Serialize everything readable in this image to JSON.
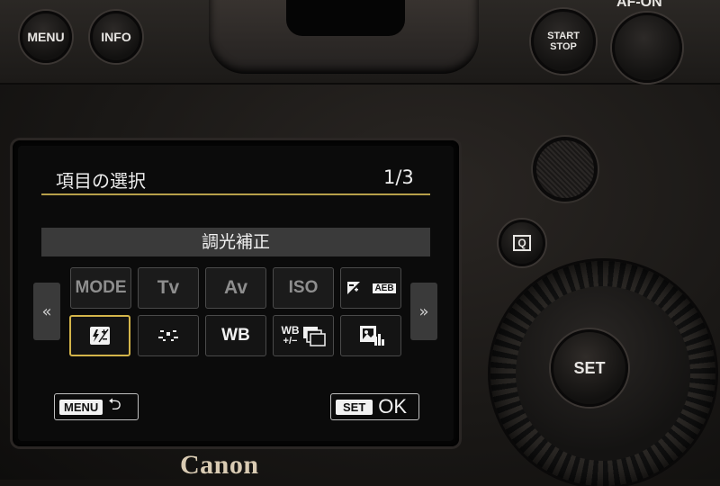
{
  "camera": {
    "brand": "Canon",
    "buttons": {
      "menu": "MENU",
      "info": "INFO",
      "start_stop_line1": "START",
      "start_stop_line2": "STOP",
      "af_on": "AF-ON",
      "q": "Q",
      "set": "SET"
    }
  },
  "screen": {
    "title": "項目の選択",
    "page": "1/3",
    "selected_label": "調光補正",
    "scroll_left": "«",
    "scroll_right": "»",
    "row1": [
      {
        "label": "MODE",
        "state": "dim"
      },
      {
        "label": "Tv",
        "state": "dim"
      },
      {
        "label": "Av",
        "state": "dim"
      },
      {
        "label": "ISO",
        "state": "dim"
      },
      {
        "label": "AEB",
        "icon": "exposure-comp-aeb-icon",
        "state": "bright"
      }
    ],
    "row2": [
      {
        "icon": "flash-exposure-comp-icon",
        "state": "selected"
      },
      {
        "icon": "metering-icon",
        "state": "bright"
      },
      {
        "label": "WB",
        "state": "bright"
      },
      {
        "label": "WB",
        "sub": "+/−",
        "icon": "wb-bracketing-icon",
        "state": "bright"
      },
      {
        "icon": "picture-style-icon",
        "state": "bright"
      }
    ],
    "footer": {
      "menu_tag": "MENU",
      "set_tag": "SET",
      "ok": "OK"
    }
  },
  "colors": {
    "highlight": "#d4b54a",
    "rule": "#b79f4a",
    "bar": "#3a3a3a"
  }
}
